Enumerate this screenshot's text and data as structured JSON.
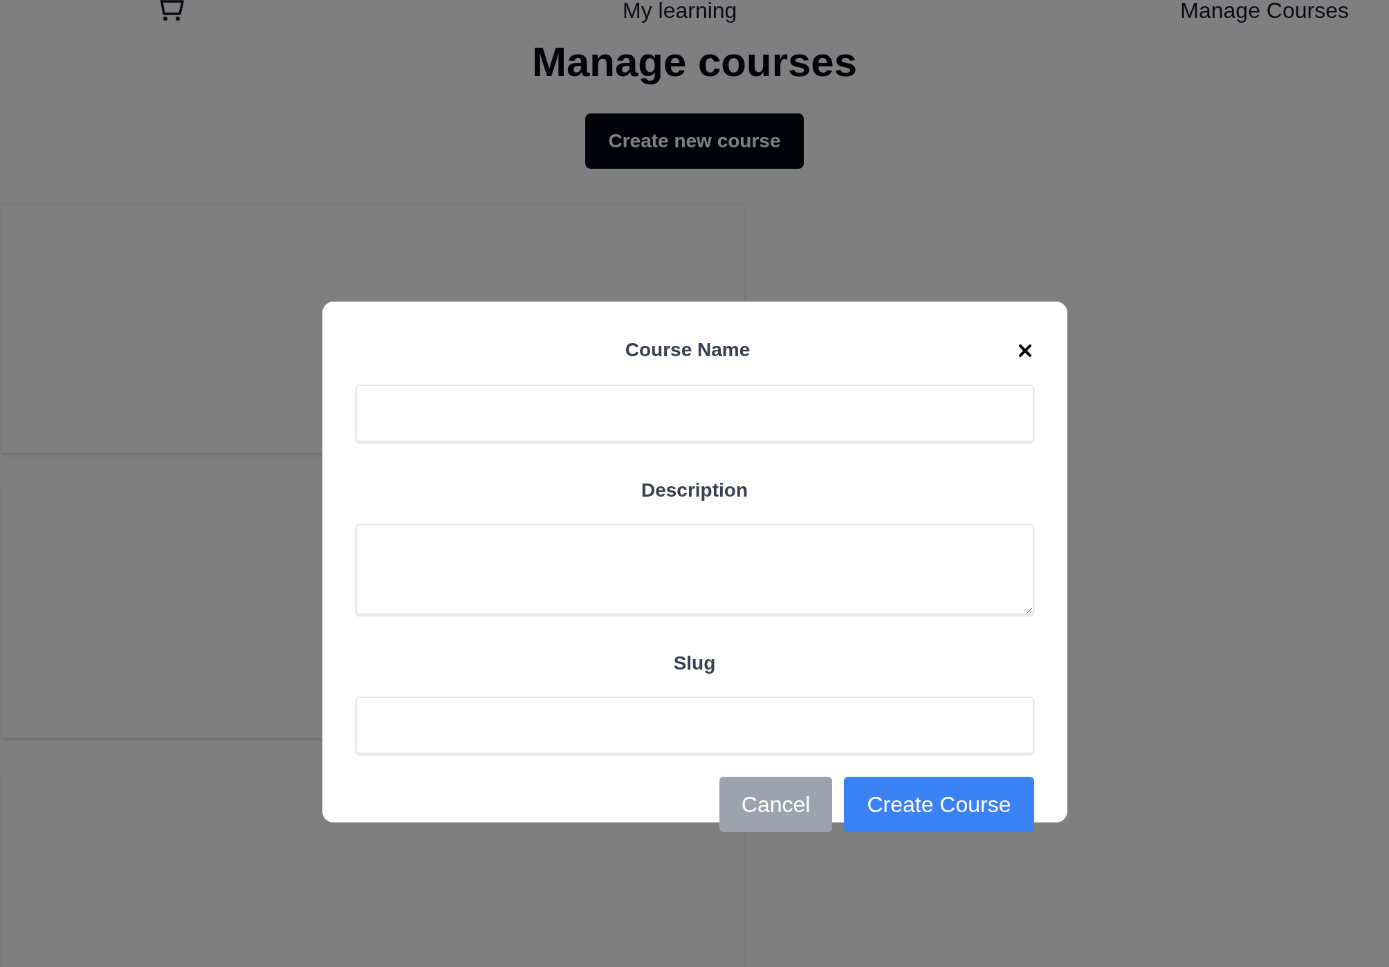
{
  "nav": {
    "items": [
      {
        "label": "My learning"
      },
      {
        "label": "Manage Courses"
      }
    ]
  },
  "page": {
    "title": "Manage courses",
    "create_button": "Create new course"
  },
  "modal": {
    "fields": [
      {
        "label": "Course Name",
        "kind": "input"
      },
      {
        "label": "Description",
        "kind": "textarea"
      },
      {
        "label": "Slug",
        "kind": "input"
      }
    ],
    "buttons": [
      {
        "label": "Cancel",
        "kind": "secondary"
      },
      {
        "label": "Create Course",
        "kind": "primary"
      }
    ]
  }
}
